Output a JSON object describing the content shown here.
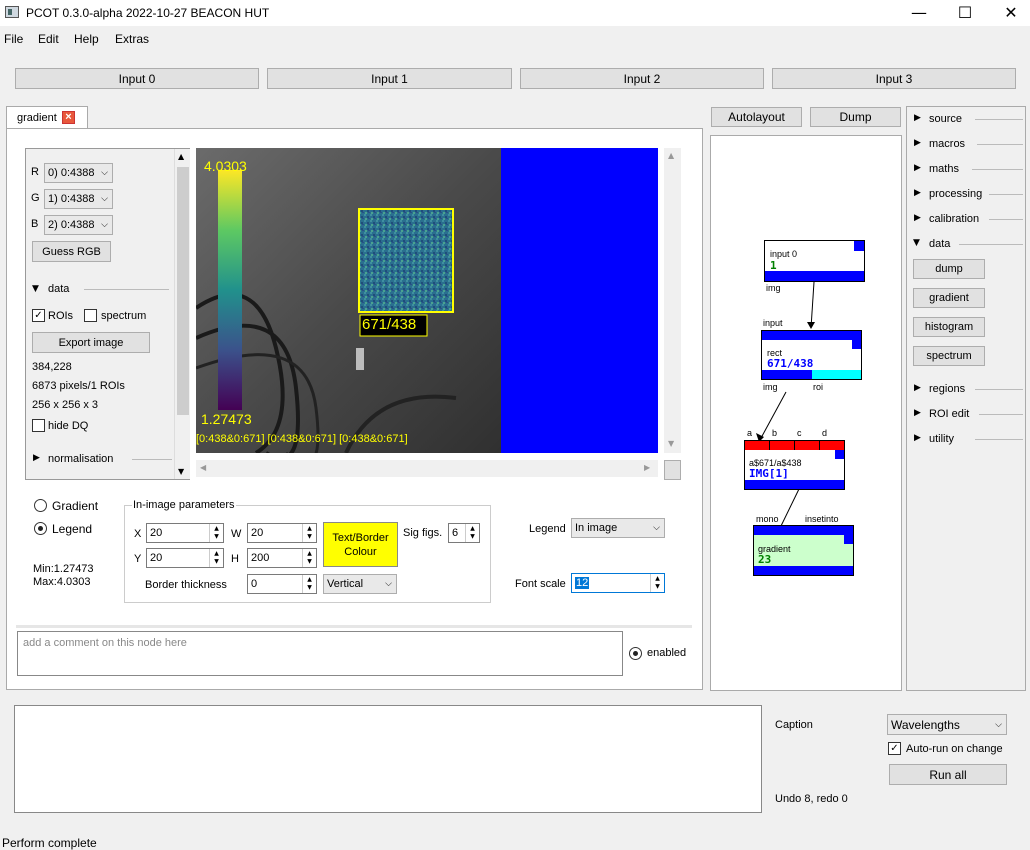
{
  "window": {
    "title": "PCOT 0.3.0-alpha 2022-10-27 BEACON HUT",
    "minimize": "—",
    "maximize": "☐",
    "close": "✕"
  },
  "menu": [
    "File",
    "Edit",
    "Help",
    "Extras"
  ],
  "inputs": [
    "Input 0",
    "Input 1",
    "Input 2",
    "Input 3"
  ],
  "tab": {
    "label": "gradient",
    "close": "×"
  },
  "left_controls": {
    "channels": [
      {
        "label": "R",
        "value": "0) 0:4388"
      },
      {
        "label": "G",
        "value": "1) 0:4388"
      },
      {
        "label": "B",
        "value": "2) 0:4388"
      }
    ],
    "guess_rgb": "Guess RGB",
    "data_section": "data",
    "rois_label": "ROIs",
    "spectrum_label": "spectrum",
    "export_image": "Export image",
    "coords": "384,228",
    "pixels": "6873 pixels/1 ROIs",
    "dims": "256 x 256 x 3",
    "hide_dq": "hide DQ",
    "normalisation": "normalisation",
    "check": "✓"
  },
  "canvas": {
    "legend_max": "4.0303",
    "legend_min": "1.27473",
    "roi_label": "671/438",
    "bottom_caption": "[0:438&0:671] [0:438&0:671] [0:438&0:671]"
  },
  "mode": {
    "gradient": "Gradient",
    "legend": "Legend",
    "min": "Min:1.27473",
    "max": "Max:4.0303"
  },
  "in_image": {
    "title": "In-image parameters",
    "x_label": "X",
    "x_value": "20",
    "y_label": "Y",
    "y_value": "20",
    "w_label": "W",
    "w_value": "20",
    "h_label": "H",
    "h_value": "200",
    "text_border_colour": "Text/Border\nColour",
    "sig_figs_label": "Sig figs.",
    "sig_figs_value": "6",
    "border_thickness_label": "Border thickness",
    "border_thickness_value": "0",
    "orientation": "Vertical"
  },
  "legend_opts": {
    "legend_label": "Legend",
    "legend_value": "In image",
    "font_scale_label": "Font scale",
    "font_scale_value": "12"
  },
  "comment": {
    "placeholder": "add a comment on this node here",
    "enabled": "enabled"
  },
  "graph": {
    "autolayout": "Autolayout",
    "dump": "Dump",
    "nodes": {
      "input0": {
        "title": "input 0",
        "value": "1",
        "out": "img"
      },
      "rect": {
        "in": "input",
        "title": "rect",
        "value": "671/438",
        "out1": "img",
        "out2": "roi"
      },
      "expr": {
        "ports": [
          "a",
          "b",
          "c",
          "d"
        ],
        "title": "a$671/a$438",
        "value": "IMG[1]"
      },
      "gradient": {
        "in1": "mono",
        "in2": "insetinto",
        "title": "gradient",
        "value": "23"
      }
    },
    "colors": {
      "blue": "#0000ff",
      "red": "#ff0000",
      "cyan": "#00ffff",
      "green_bg": "#ccffcc"
    }
  },
  "palette": {
    "sections": [
      "source",
      "macros",
      "maths",
      "processing",
      "calibration",
      "data"
    ],
    "data_buttons": [
      "dump",
      "gradient",
      "histogram",
      "spectrum"
    ],
    "sections_after": [
      "regions",
      "ROI edit",
      "utility"
    ]
  },
  "bottom": {
    "caption_label": "Caption",
    "caption_value": "Wavelengths",
    "auto_run": "Auto-run on change",
    "run_all": "Run all",
    "undo_redo": "Undo 8, redo 0"
  },
  "status": "Perform complete"
}
